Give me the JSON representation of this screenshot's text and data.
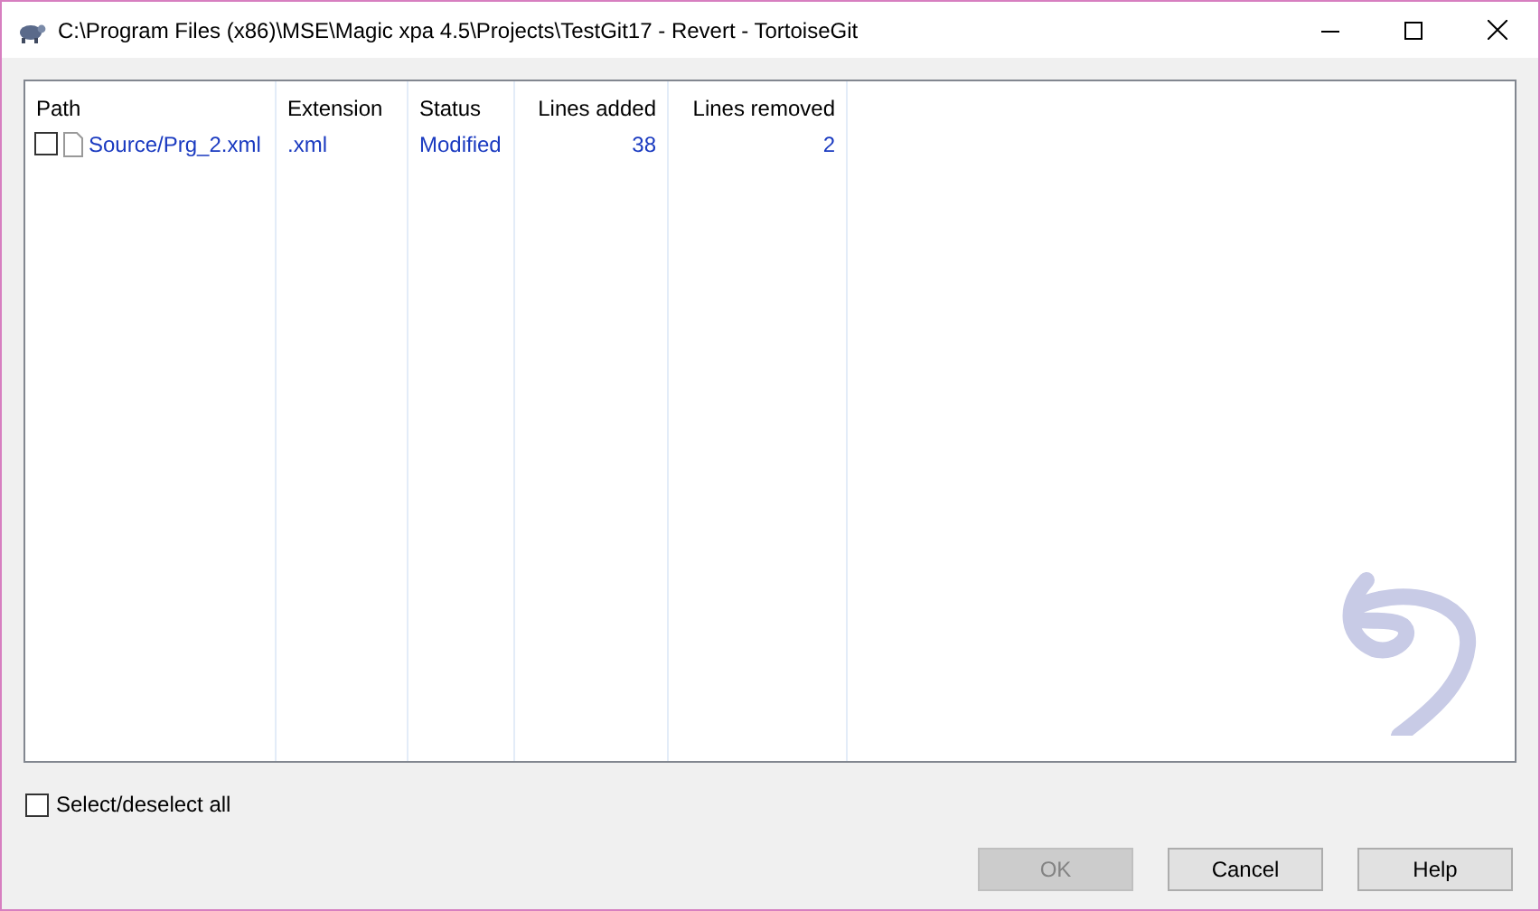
{
  "window": {
    "title": "C:\\Program Files (x86)\\MSE\\Magic xpa 4.5\\Projects\\TestGit17 - Revert - TortoiseGit"
  },
  "table": {
    "columns": [
      {
        "label": "Path",
        "kind": "text"
      },
      {
        "label": "Extension",
        "kind": "text"
      },
      {
        "label": "Status",
        "kind": "text"
      },
      {
        "label": "Lines added",
        "kind": "number"
      },
      {
        "label": "Lines removed",
        "kind": "number"
      }
    ],
    "rows": [
      {
        "checked": false,
        "cells": [
          "Source/Prg_2.xml",
          ".xml",
          "Modified",
          "38",
          "2"
        ]
      }
    ]
  },
  "select_all": {
    "label": "Select/deselect all",
    "checked": false
  },
  "buttons": [
    {
      "label": "OK",
      "disabled": true
    },
    {
      "label": "Cancel",
      "disabled": false
    },
    {
      "label": "Help",
      "disabled": false
    }
  ]
}
